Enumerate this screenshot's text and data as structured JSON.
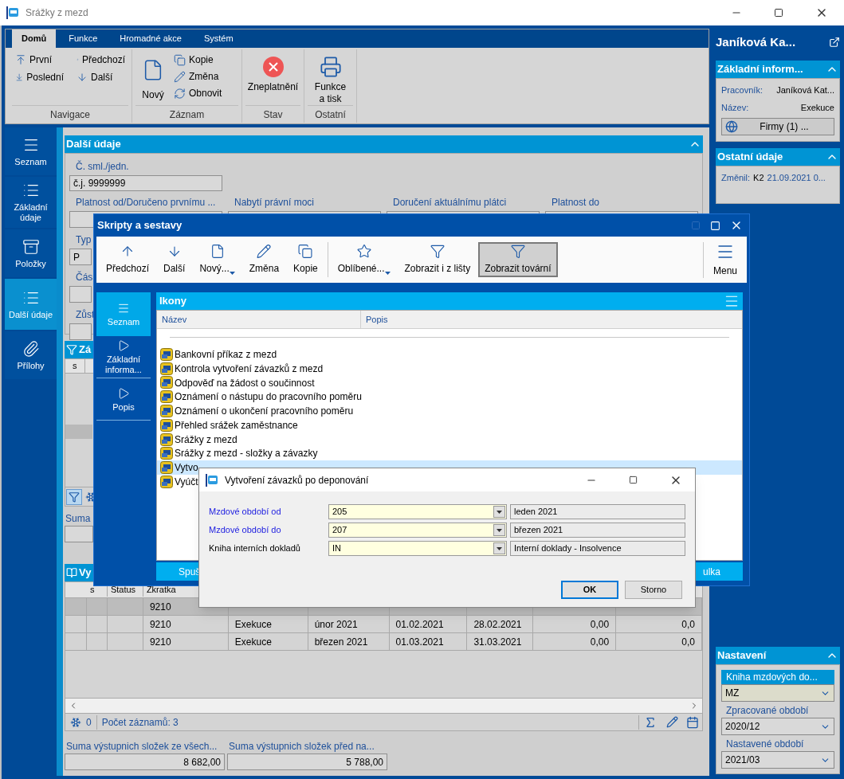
{
  "window": {
    "title": "Srážky z mezd"
  },
  "ribbon": {
    "tabs": [
      {
        "label": "Domů",
        "selected": true
      },
      {
        "label": "Funkce",
        "selected": false
      },
      {
        "label": "Hromadné akce",
        "selected": false
      },
      {
        "label": "Systém",
        "selected": false
      }
    ],
    "groups": [
      {
        "label": "Navigace",
        "kind": "grid",
        "buttons": [
          "První",
          "Předchozí",
          "Poslední",
          "Další"
        ]
      },
      {
        "label": "Záznam",
        "kind": "mixed",
        "buttons": [
          "Nový",
          "Kopie",
          "Změna",
          "Obnovit"
        ]
      },
      {
        "label": "Stav",
        "kind": "large",
        "buttons": [
          "Zneplatnění"
        ]
      },
      {
        "label": "Ostatní",
        "kind": "large",
        "buttons": [
          "Funkce a tisk"
        ]
      }
    ]
  },
  "nav": {
    "items": [
      {
        "label": "Seznam",
        "selected": false
      },
      {
        "label": "Základní údaje",
        "selected": false
      },
      {
        "label": "Položky",
        "selected": false
      },
      {
        "label": "Další údaje",
        "selected": true
      },
      {
        "label": "Přílohy",
        "selected": false
      }
    ]
  },
  "form": {
    "title": "Další údaje",
    "contract": {
      "label": "Č. sml./jedn.",
      "value": "č.j. 9999999"
    },
    "date_fields": [
      {
        "label": "Platnost od/Doručeno prvnímu ..."
      },
      {
        "label": "Nabytí právní moci"
      },
      {
        "label": "Doručení aktuálnímu plátci"
      },
      {
        "label": "Platnost do"
      }
    ],
    "partial_fields": [
      {
        "label": "Typ",
        "value": "P"
      },
      {
        "label": "Čás"
      },
      {
        "label": "Zůst"
      }
    ]
  },
  "filter_panel": {
    "title": "Zá",
    "columns": [
      "s"
    ]
  },
  "suma_field": {
    "label": "Suma"
  },
  "items_panel": {
    "title": "Vy",
    "columns": [
      "s",
      "Status",
      "Zkratka"
    ],
    "rows": [
      {
        "selected": true,
        "cells": [
          "",
          "",
          "9210"
        ]
      },
      {
        "selected": false,
        "cells": [
          "",
          "",
          "9210",
          "Exekuce",
          "únor 2021",
          "01.02.2021",
          "28.02.2021",
          "0,00",
          "0,0"
        ]
      },
      {
        "selected": false,
        "cells": [
          "",
          "",
          "9210",
          "Exekuce",
          "březen 2021",
          "01.03.2021",
          "31.03.2021",
          "0,00",
          "0,0"
        ]
      }
    ],
    "status": {
      "count": "0",
      "records": "Počet záznamů: 3"
    }
  },
  "totals": [
    {
      "label": "Suma výstupnich složek ze všech...",
      "value": "8 682,00"
    },
    {
      "label": "Suma výstupnich složek před na...",
      "value": "5 788,00"
    }
  ],
  "side": {
    "title": "Janíková Ka...",
    "basic": {
      "title": "Základní inform...",
      "rows": [
        {
          "label": "Pracovník:",
          "value": "Janíková Kat..."
        },
        {
          "label": "Název:",
          "value": "Exekuce"
        }
      ],
      "button": "Firmy (1) ..."
    },
    "other": {
      "title": "Ostatní údaje",
      "label": "Změnil:",
      "user": "K2",
      "value": "21.09.2021 0..."
    },
    "settings": {
      "title": "Nastavení",
      "fields": [
        {
          "label": "Kniha mzdových do...",
          "value": "MZ",
          "selected": true
        },
        {
          "label": "Zpracované období",
          "value": "2020/12",
          "selected": false
        },
        {
          "label": "Nastavené období",
          "value": "2021/03",
          "selected": false
        }
      ]
    }
  },
  "scripts_window": {
    "title": "Skripty a sestavy",
    "toolbar_groups": [
      [
        {
          "label": "Předchozí",
          "dropdown": false,
          "selected": false
        },
        {
          "label": "Další",
          "dropdown": false,
          "selected": false
        },
        {
          "label": "Nový...",
          "dropdown": true,
          "selected": false
        },
        {
          "label": "Změna",
          "dropdown": false,
          "selected": false
        },
        {
          "label": "Kopie",
          "dropdown": false,
          "selected": false
        }
      ],
      [
        {
          "label": "Oblíbené...",
          "dropdown": true,
          "selected": false
        },
        {
          "label": "Zobrazit i z lišty",
          "dropdown": false,
          "selected": false
        },
        {
          "label": "Zobrazit tovární",
          "dropdown": false,
          "selected": true
        }
      ]
    ],
    "menu": "Menu",
    "nav": [
      {
        "label": "Seznam",
        "selected": true
      },
      {
        "label": "Základní informa...",
        "selected": false
      },
      {
        "label": "Popis",
        "selected": false
      }
    ],
    "list_title": "Ikony",
    "columns": [
      "Název",
      "Popis"
    ],
    "items": [
      {
        "name": "Bankovní příkaz z mezd",
        "selected": false
      },
      {
        "name": "Kontrola vytvoření závazků z mezd",
        "selected": false
      },
      {
        "name": "Odpověď na žádost o součinnost",
        "selected": false
      },
      {
        "name": "Oznámení o nástupu do pracovního poměru",
        "selected": false
      },
      {
        "name": "Oznámení o ukončení pracovního poměru",
        "selected": false
      },
      {
        "name": "Přehled srážek zaměstnance",
        "selected": false
      },
      {
        "name": "Srážky z mezd",
        "selected": false
      },
      {
        "name": "Srážky z mezd - složky a závazky",
        "selected": false
      },
      {
        "name": "Vytvo",
        "selected": true
      },
      {
        "name": "Vyúčt",
        "selected": false
      }
    ],
    "footer": [
      "Spuš",
      "ulka"
    ]
  },
  "dialog": {
    "title": "Vytvoření závazků po deponování",
    "fields": [
      {
        "label": "Mzdové období od",
        "value": "205",
        "description": "leden 2021",
        "required": true
      },
      {
        "label": "Mzdové období do",
        "value": "207",
        "description": "březen 2021",
        "required": true
      },
      {
        "label": "Kniha interních dokladů",
        "value": "IN",
        "description": "Interní doklady - Insolvence",
        "required": false
      }
    ],
    "buttons": [
      {
        "label": "OK",
        "default": true
      },
      {
        "label": "Storno",
        "default": false
      }
    ]
  }
}
